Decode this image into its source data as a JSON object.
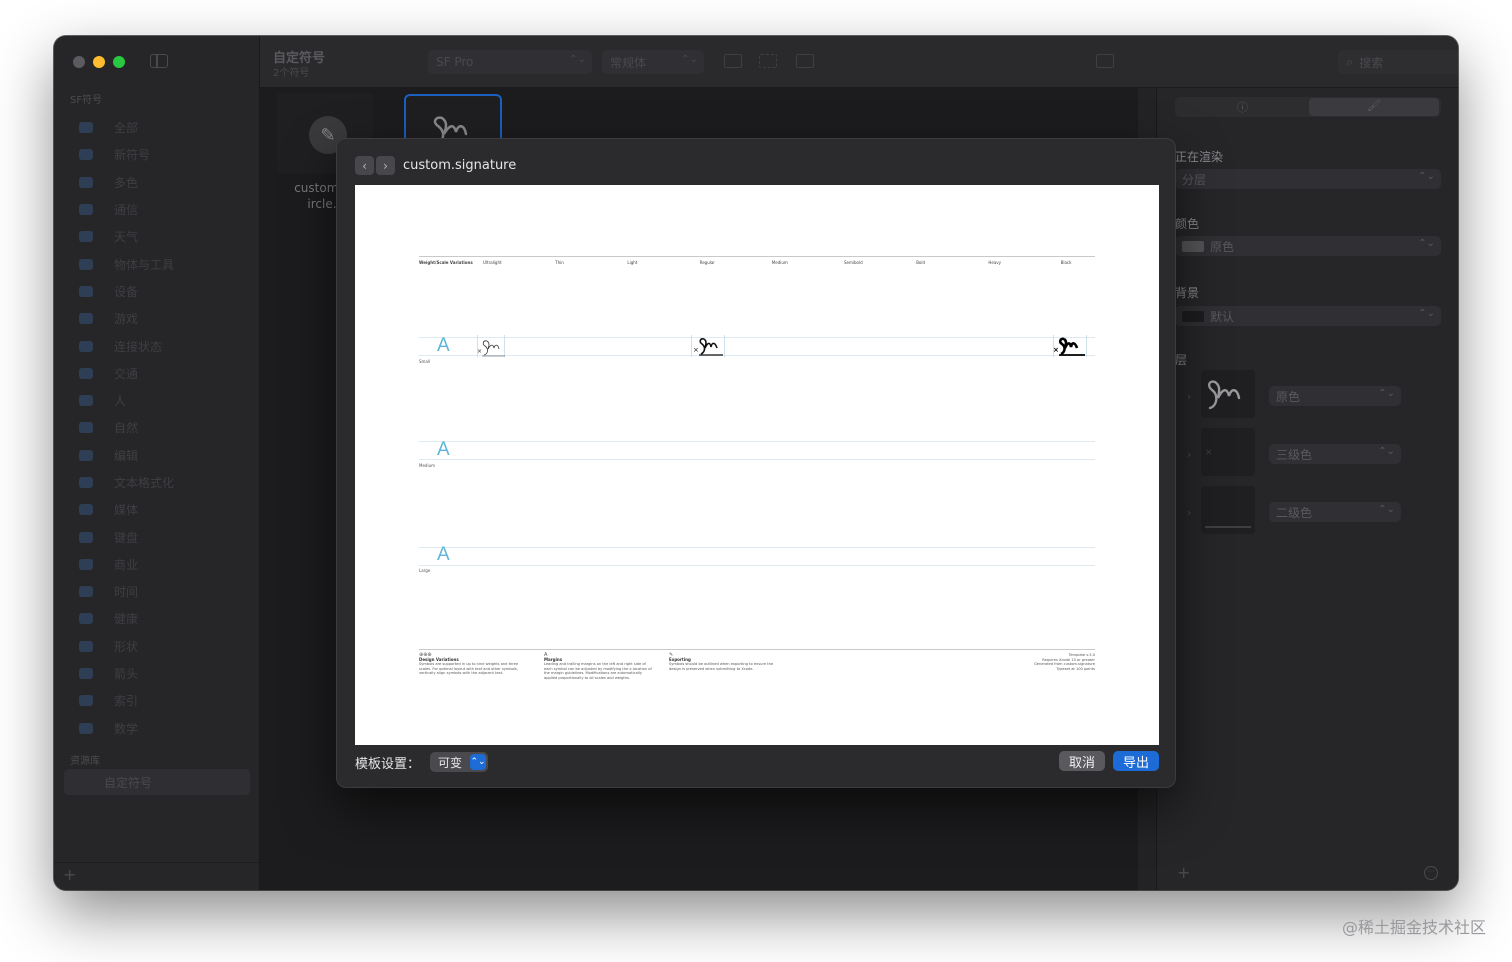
{
  "window": {
    "toolbar": {
      "title": "自定符号",
      "subtitle": "2个符号",
      "font_family_value": "SF Pro",
      "font_weight_value": "常规体",
      "search_placeholder": "搜索"
    },
    "sidebar": {
      "section_sf": "SF符号",
      "items": [
        {
          "label": "全部"
        },
        {
          "label": "新符号"
        },
        {
          "label": "多色"
        },
        {
          "label": "通信"
        },
        {
          "label": "天气"
        },
        {
          "label": "物体与工具"
        },
        {
          "label": "设备"
        },
        {
          "label": "游戏"
        },
        {
          "label": "连接状态"
        },
        {
          "label": "交通"
        },
        {
          "label": "人"
        },
        {
          "label": "自然"
        },
        {
          "label": "编辑"
        },
        {
          "label": "文本格式化"
        },
        {
          "label": "媒体"
        },
        {
          "label": "键盘"
        },
        {
          "label": "商业"
        },
        {
          "label": "时间"
        },
        {
          "label": "健康"
        },
        {
          "label": "形状"
        },
        {
          "label": "箭头"
        },
        {
          "label": "索引"
        },
        {
          "label": "数学"
        }
      ],
      "section_library": "资源库",
      "library_item": "自定符号",
      "add_label": "+"
    },
    "grid": {
      "tile1_label_line1": "custom.p",
      "tile1_label_line2": "ircle.",
      "tile1_icon": "pencil-icon",
      "tile2_icon": "signature-icon"
    },
    "inspector": {
      "info_icon": "ⓘ",
      "paint_icon": "🖌",
      "rendering_label": "正在渲染",
      "rendering_value": "分层",
      "color_label": "颜色",
      "color_value": "原色",
      "background_label": "背景",
      "background_value": "默认",
      "layers_label": "层",
      "layers": [
        {
          "value": "原色"
        },
        {
          "value": "三级色"
        },
        {
          "value": "二级色"
        }
      ],
      "add_label": "+",
      "more_label": "···"
    }
  },
  "sheet": {
    "title": "custom.signature",
    "nav_back": "‹",
    "nav_forward": "›",
    "template_label": "模板设置：",
    "template_value": "可变",
    "cancel_label": "取消",
    "export_label": "导出",
    "preview": {
      "header_title": "Weight/Scale Variations",
      "weights": [
        "Ultralight",
        "Thin",
        "Light",
        "Regular",
        "Medium",
        "Semibold",
        "Bold",
        "Heavy",
        "Black"
      ],
      "rows": [
        {
          "label": "Small",
          "glyph": "A"
        },
        {
          "label": "Medium",
          "glyph": "A"
        },
        {
          "label": "Large",
          "glyph": "A"
        }
      ],
      "footer": {
        "col1_title": "Design Variations",
        "col1_text": "Symbols are supported in up to nine weights and three scales. For optimal layout with text and other symbols, vertically align symbols with the adjacent text.",
        "col2_title": "Margins",
        "col2_text": "Leading and trailing margins on the left and right side of each symbol can be adjusted by modifying the x-location of the margin guidelines. Modifications are automatically applied proportionally to all scales and weights.",
        "col3_title": "Exporting",
        "col3_text": "Symbols should be outlined when exporting to ensure the design is preserved when submitting to Xcode.",
        "col4_line1": "Template v.3.0",
        "col4_line2": "Requires Xcode 13 or greater",
        "col4_line3": "Generated from custom.signature",
        "col4_line4": "Typeset at 100 points"
      }
    }
  },
  "watermark": "@稀土掘金技术社区",
  "colors": {
    "accent": "#1d6bd6",
    "window_bg": "#1f1f21",
    "template_guide": "#5fb6d9"
  }
}
